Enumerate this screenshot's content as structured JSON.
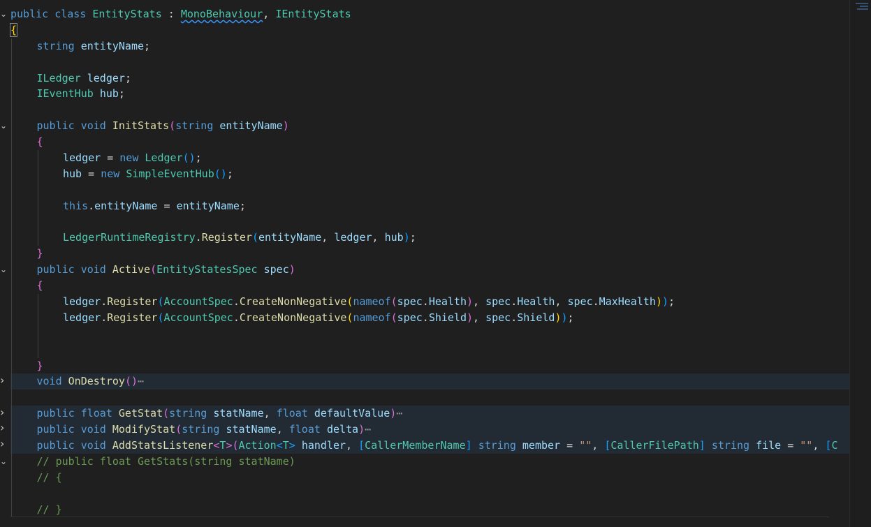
{
  "editor": {
    "language": "csharp",
    "lines": [
      {
        "fold": "expanded",
        "indent": 0,
        "highlight": false,
        "tokens": [
          [
            "kw",
            "public"
          ],
          [
            "pl",
            " "
          ],
          [
            "kw",
            "class"
          ],
          [
            "pl",
            " "
          ],
          [
            "ty",
            "EntityStats"
          ],
          [
            "pl",
            " : "
          ],
          [
            "ty squig",
            "MonoBehaviour"
          ],
          [
            "pl",
            ", "
          ],
          [
            "ty",
            "IEntityStats"
          ]
        ]
      },
      {
        "fold": "",
        "indent": 0,
        "highlight": false,
        "tokens": [
          [
            "b1 cursorbox",
            "{"
          ]
        ]
      },
      {
        "fold": "",
        "indent": 1,
        "highlight": false,
        "tokens": [
          [
            "kw",
            "string"
          ],
          [
            "pl",
            " "
          ],
          [
            "va",
            "entityName"
          ],
          [
            "pl",
            ";"
          ]
        ]
      },
      {
        "fold": "",
        "indent": 1,
        "highlight": false,
        "tokens": []
      },
      {
        "fold": "",
        "indent": 1,
        "highlight": false,
        "tokens": [
          [
            "ty",
            "ILedger"
          ],
          [
            "pl",
            " "
          ],
          [
            "va",
            "ledger"
          ],
          [
            "pl",
            ";"
          ]
        ]
      },
      {
        "fold": "",
        "indent": 1,
        "highlight": false,
        "tokens": [
          [
            "ty",
            "IEventHub"
          ],
          [
            "pl",
            " "
          ],
          [
            "va",
            "hub"
          ],
          [
            "pl",
            ";"
          ]
        ]
      },
      {
        "fold": "",
        "indent": 1,
        "highlight": false,
        "tokens": []
      },
      {
        "fold": "expanded",
        "indent": 1,
        "highlight": false,
        "tokens": [
          [
            "kw",
            "public"
          ],
          [
            "pl",
            " "
          ],
          [
            "kw",
            "void"
          ],
          [
            "pl",
            " "
          ],
          [
            "fn",
            "InitStats"
          ],
          [
            "b2",
            "("
          ],
          [
            "kw",
            "string"
          ],
          [
            "pl",
            " "
          ],
          [
            "va",
            "entityName"
          ],
          [
            "b2",
            ")"
          ]
        ]
      },
      {
        "fold": "",
        "indent": 1,
        "highlight": false,
        "tokens": [
          [
            "b2",
            "{"
          ]
        ]
      },
      {
        "fold": "",
        "indent": 2,
        "highlight": false,
        "tokens": [
          [
            "va",
            "ledger"
          ],
          [
            "pl",
            " = "
          ],
          [
            "kw",
            "new"
          ],
          [
            "pl",
            " "
          ],
          [
            "ty",
            "Ledger"
          ],
          [
            "b3",
            "()"
          ],
          [
            "pl",
            ";"
          ]
        ]
      },
      {
        "fold": "",
        "indent": 2,
        "highlight": false,
        "tokens": [
          [
            "va",
            "hub"
          ],
          [
            "pl",
            " = "
          ],
          [
            "kw",
            "new"
          ],
          [
            "pl",
            " "
          ],
          [
            "ty",
            "SimpleEventHub"
          ],
          [
            "b3",
            "()"
          ],
          [
            "pl",
            ";"
          ]
        ]
      },
      {
        "fold": "",
        "indent": 2,
        "highlight": false,
        "tokens": []
      },
      {
        "fold": "",
        "indent": 2,
        "highlight": false,
        "tokens": [
          [
            "kw",
            "this"
          ],
          [
            "pl",
            "."
          ],
          [
            "va",
            "entityName"
          ],
          [
            "pl",
            " = "
          ],
          [
            "va",
            "entityName"
          ],
          [
            "pl",
            ";"
          ]
        ]
      },
      {
        "fold": "",
        "indent": 2,
        "highlight": false,
        "tokens": []
      },
      {
        "fold": "",
        "indent": 2,
        "highlight": false,
        "tokens": [
          [
            "ty",
            "LedgerRuntimeRegistry"
          ],
          [
            "pl",
            "."
          ],
          [
            "fn",
            "Register"
          ],
          [
            "b3",
            "("
          ],
          [
            "va",
            "entityName"
          ],
          [
            "pl",
            ", "
          ],
          [
            "va",
            "ledger"
          ],
          [
            "pl",
            ", "
          ],
          [
            "va",
            "hub"
          ],
          [
            "b3",
            ")"
          ],
          [
            "pl",
            ";"
          ]
        ]
      },
      {
        "fold": "",
        "indent": 1,
        "highlight": false,
        "tokens": [
          [
            "b2",
            "}"
          ]
        ]
      },
      {
        "fold": "expanded",
        "indent": 1,
        "highlight": false,
        "tokens": [
          [
            "kw",
            "public"
          ],
          [
            "pl",
            " "
          ],
          [
            "kw",
            "void"
          ],
          [
            "pl",
            " "
          ],
          [
            "fn",
            "Active"
          ],
          [
            "b2",
            "("
          ],
          [
            "ty",
            "EntityStatesSpec"
          ],
          [
            "pl",
            " "
          ],
          [
            "va",
            "spec"
          ],
          [
            "b2",
            ")"
          ]
        ]
      },
      {
        "fold": "",
        "indent": 1,
        "highlight": false,
        "tokens": [
          [
            "b2",
            "{"
          ]
        ]
      },
      {
        "fold": "",
        "indent": 2,
        "highlight": false,
        "tokens": [
          [
            "va",
            "ledger"
          ],
          [
            "pl",
            "."
          ],
          [
            "fn",
            "Register"
          ],
          [
            "b3",
            "("
          ],
          [
            "ty",
            "AccountSpec"
          ],
          [
            "pl",
            "."
          ],
          [
            "fn",
            "CreateNonNegative"
          ],
          [
            "b1",
            "("
          ],
          [
            "kw",
            "nameof"
          ],
          [
            "b2",
            "("
          ],
          [
            "va",
            "spec"
          ],
          [
            "pl",
            "."
          ],
          [
            "va",
            "Health"
          ],
          [
            "b2",
            ")"
          ],
          [
            "pl",
            ", "
          ],
          [
            "va",
            "spec"
          ],
          [
            "pl",
            "."
          ],
          [
            "va",
            "Health"
          ],
          [
            "pl",
            ", "
          ],
          [
            "va",
            "spec"
          ],
          [
            "pl",
            "."
          ],
          [
            "va",
            "MaxHealth"
          ],
          [
            "b1",
            ")"
          ],
          [
            "b3",
            ")"
          ],
          [
            "pl",
            ";"
          ]
        ]
      },
      {
        "fold": "",
        "indent": 2,
        "highlight": false,
        "tokens": [
          [
            "va",
            "ledger"
          ],
          [
            "pl",
            "."
          ],
          [
            "fn",
            "Register"
          ],
          [
            "b3",
            "("
          ],
          [
            "ty",
            "AccountSpec"
          ],
          [
            "pl",
            "."
          ],
          [
            "fn",
            "CreateNonNegative"
          ],
          [
            "b1",
            "("
          ],
          [
            "kw",
            "nameof"
          ],
          [
            "b2",
            "("
          ],
          [
            "va",
            "spec"
          ],
          [
            "pl",
            "."
          ],
          [
            "va",
            "Shield"
          ],
          [
            "b2",
            ")"
          ],
          [
            "pl",
            ", "
          ],
          [
            "va",
            "spec"
          ],
          [
            "pl",
            "."
          ],
          [
            "va",
            "Shield"
          ],
          [
            "b1",
            ")"
          ],
          [
            "b3",
            ")"
          ],
          [
            "pl",
            ";"
          ]
        ]
      },
      {
        "fold": "",
        "indent": 2,
        "highlight": false,
        "tokens": []
      },
      {
        "fold": "",
        "indent": 2,
        "highlight": false,
        "tokens": []
      },
      {
        "fold": "",
        "indent": 1,
        "highlight": false,
        "tokens": [
          [
            "b2",
            "}"
          ]
        ]
      },
      {
        "fold": "collapsed",
        "indent": 1,
        "highlight": true,
        "tokens": [
          [
            "kw",
            "void"
          ],
          [
            "pl",
            " "
          ],
          [
            "fn",
            "OnDestroy"
          ],
          [
            "b2",
            "()"
          ],
          [
            "ell",
            "⋯"
          ]
        ]
      },
      {
        "fold": "",
        "indent": 1,
        "highlight": false,
        "tokens": []
      },
      {
        "fold": "collapsed",
        "indent": 1,
        "highlight": true,
        "tokens": [
          [
            "kw",
            "public"
          ],
          [
            "pl",
            " "
          ],
          [
            "kw",
            "float"
          ],
          [
            "pl",
            " "
          ],
          [
            "fn",
            "GetStat"
          ],
          [
            "b2",
            "("
          ],
          [
            "kw",
            "string"
          ],
          [
            "pl",
            " "
          ],
          [
            "va",
            "statName"
          ],
          [
            "pl",
            ", "
          ],
          [
            "kw",
            "float"
          ],
          [
            "pl",
            " "
          ],
          [
            "va",
            "defaultValue"
          ],
          [
            "b2",
            ")"
          ],
          [
            "ell",
            "⋯"
          ]
        ]
      },
      {
        "fold": "collapsed",
        "indent": 1,
        "highlight": true,
        "tokens": [
          [
            "kw",
            "public"
          ],
          [
            "pl",
            " "
          ],
          [
            "kw",
            "void"
          ],
          [
            "pl",
            " "
          ],
          [
            "fn",
            "ModifyStat"
          ],
          [
            "b2",
            "("
          ],
          [
            "kw",
            "string"
          ],
          [
            "pl",
            " "
          ],
          [
            "va",
            "statName"
          ],
          [
            "pl",
            ", "
          ],
          [
            "kw",
            "float"
          ],
          [
            "pl",
            " "
          ],
          [
            "va",
            "delta"
          ],
          [
            "b2",
            ")"
          ],
          [
            "ell",
            "⋯"
          ]
        ]
      },
      {
        "fold": "collapsed",
        "indent": 1,
        "highlight": true,
        "tokens": [
          [
            "kw",
            "public"
          ],
          [
            "pl",
            " "
          ],
          [
            "kw",
            "void"
          ],
          [
            "pl",
            " "
          ],
          [
            "fn",
            "AddStatsListener"
          ],
          [
            "b2",
            "<"
          ],
          [
            "ty",
            "T"
          ],
          [
            "b2",
            ">"
          ],
          [
            "b2",
            "("
          ],
          [
            "ty",
            "Action"
          ],
          [
            "b3",
            "<"
          ],
          [
            "ty",
            "T"
          ],
          [
            "b3",
            ">"
          ],
          [
            "pl",
            " "
          ],
          [
            "va",
            "handler"
          ],
          [
            "pl",
            ", "
          ],
          [
            "b3",
            "["
          ],
          [
            "ty",
            "CallerMemberName"
          ],
          [
            "b3",
            "]"
          ],
          [
            "pl",
            " "
          ],
          [
            "kw",
            "string"
          ],
          [
            "pl",
            " "
          ],
          [
            "va",
            "member"
          ],
          [
            "pl",
            " = "
          ],
          [
            "st",
            "\"\""
          ],
          [
            "pl",
            ", "
          ],
          [
            "b3",
            "["
          ],
          [
            "ty",
            "CallerFilePath"
          ],
          [
            "b3",
            "]"
          ],
          [
            "pl",
            " "
          ],
          [
            "kw",
            "string"
          ],
          [
            "pl",
            " "
          ],
          [
            "va",
            "file"
          ],
          [
            "pl",
            " = "
          ],
          [
            "st",
            "\"\""
          ],
          [
            "pl",
            ", "
          ],
          [
            "b3",
            "["
          ],
          [
            "ty",
            "C"
          ]
        ]
      },
      {
        "fold": "expanded",
        "indent": 1,
        "highlight": false,
        "tokens": [
          [
            "cm",
            "// public float GetStats(string statName)"
          ]
        ]
      },
      {
        "fold": "",
        "indent": 1,
        "highlight": false,
        "tokens": [
          [
            "cm",
            "// {"
          ]
        ]
      },
      {
        "fold": "",
        "indent": 1,
        "highlight": false,
        "tokens": []
      },
      {
        "fold": "",
        "indent": 1,
        "highlight": false,
        "tokens": [
          [
            "cm",
            "// }"
          ]
        ]
      }
    ]
  },
  "icons": {
    "fold_expanded": "chevron-down-icon",
    "fold_collapsed": "chevron-right-icon"
  }
}
